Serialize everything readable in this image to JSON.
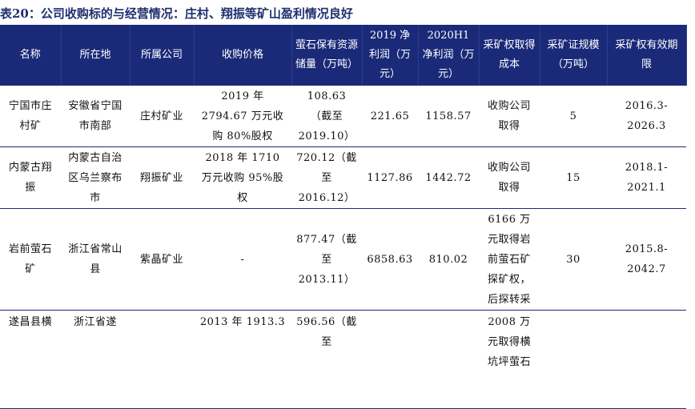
{
  "title": "表20：公司收购标的与经营情况：庄村、翔振等矿山盈利情况良好",
  "columns": [
    "名称",
    "所在地",
    "所属公司",
    "收购价格",
    "萤石保有资源储量（万吨）",
    "2019 净利润（万元）",
    "2020H1 净利润（万元）",
    "采矿权取得成本",
    "采矿证规模（万吨）",
    "采矿权有效期限"
  ],
  "rows": [
    {
      "name": "宁国市庄村矿",
      "location": "安徽省宁国市南部",
      "company": "庄村矿业",
      "price": "2019 年 2794.67 万元收购 80%股权",
      "reserve": "108.63 （截至 2019.10）",
      "profit_2019": "221.65",
      "profit_2020h1": "1158.57",
      "cost": "收购公司取得",
      "scale": "5",
      "validity": "2016.3-2026.3"
    },
    {
      "name": "内蒙古翔振",
      "location": "内蒙古自治区乌兰察布市",
      "company": "翔振矿业",
      "price": "2018 年 1710 万元收购 95%股权",
      "reserve": "720.12（截至 2016.12）",
      "profit_2019": "1127.86",
      "profit_2020h1": "1442.72",
      "cost": "收购公司取得",
      "scale": "15",
      "validity": "2018.1-2021.1"
    },
    {
      "name": "岩前萤石矿",
      "location": "浙江省常山县",
      "company": "紫晶矿业",
      "price": "-",
      "reserve": "877.47（截至 2013.11）",
      "profit_2019": "6858.63",
      "profit_2020h1": "810.02",
      "cost": "6166 万元取得岩前萤石矿探矿权，后探转采",
      "scale": "30",
      "validity": "2015.8-2042.7"
    },
    {
      "name": "遂昌县横",
      "location": "浙江省遂",
      "company": "",
      "price": "2013 年 1913.3",
      "reserve": "596.56（截至",
      "profit_2019": "",
      "profit_2020h1": "",
      "cost": "2008 万元取得横坑坪萤石",
      "scale": "",
      "validity": ""
    }
  ]
}
